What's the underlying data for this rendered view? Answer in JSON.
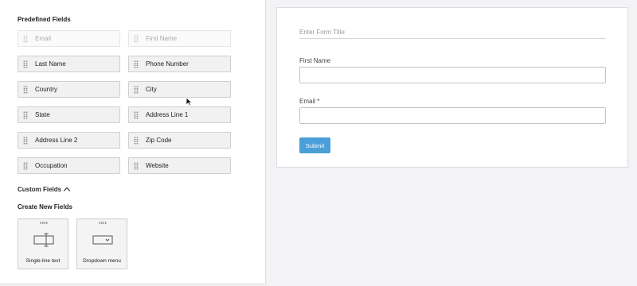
{
  "left_panel": {
    "predefined_title": "Predefined Fields",
    "predefined_fields": [
      {
        "label": "Email",
        "disabled": true
      },
      {
        "label": "First Name",
        "disabled": true
      },
      {
        "label": "Last Name",
        "disabled": false
      },
      {
        "label": "Phone Number",
        "disabled": false
      },
      {
        "label": "Country",
        "disabled": false
      },
      {
        "label": "City",
        "disabled": false
      },
      {
        "label": "State",
        "disabled": false
      },
      {
        "label": "Address Line 1",
        "disabled": false
      },
      {
        "label": "Address Line 2",
        "disabled": false
      },
      {
        "label": "Zip Code",
        "disabled": false
      },
      {
        "label": "Occupation",
        "disabled": false
      },
      {
        "label": "Website",
        "disabled": false
      }
    ],
    "custom_fields_label": "Custom Fields",
    "create_new_title": "Create New Fields",
    "new_field_types": [
      {
        "label": "Single-line text",
        "icon": "text-input-icon"
      },
      {
        "label": "Dropdown menu",
        "icon": "dropdown-icon"
      }
    ]
  },
  "form": {
    "title_placeholder": "Enter Form Title",
    "fields": [
      {
        "label": "First Name"
      },
      {
        "label": "Email *"
      }
    ],
    "submit_label": "Submit"
  },
  "colors": {
    "accent": "#4a9fd8",
    "panel_bg": "#ffffff",
    "page_bg": "#f3f3f5"
  }
}
